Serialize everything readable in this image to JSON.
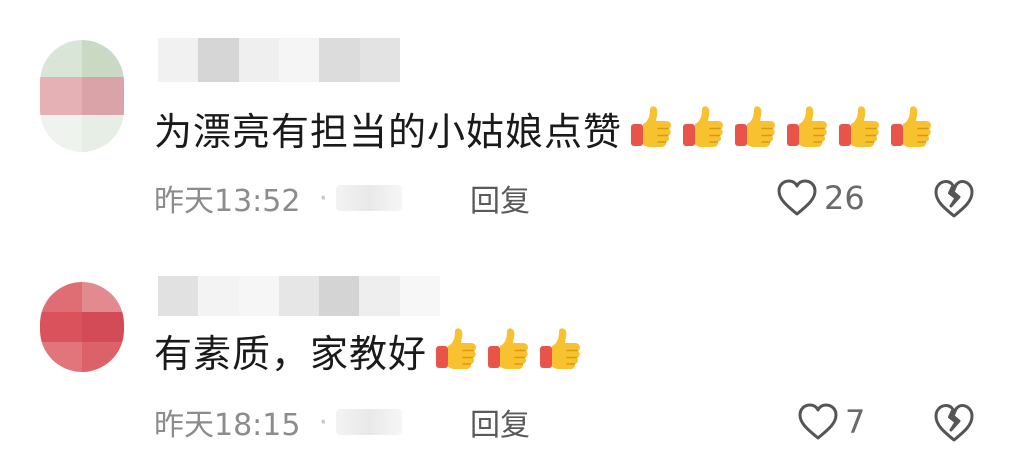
{
  "comments": [
    {
      "text": "为漂亮有担当的小姑娘点赞",
      "thumbs": 6,
      "time": "昨天13:52",
      "separator": "·",
      "reply_label": "回复",
      "likes": "26"
    },
    {
      "text": "有素质，家教好",
      "thumbs": 3,
      "time": "昨天18:15",
      "separator": "·",
      "reply_label": "回复",
      "likes": "7"
    }
  ],
  "colors": {
    "meta_text": "#8c8c8c",
    "thumb_yellow": "#f7c12f",
    "thumb_red": "#e8534a"
  }
}
